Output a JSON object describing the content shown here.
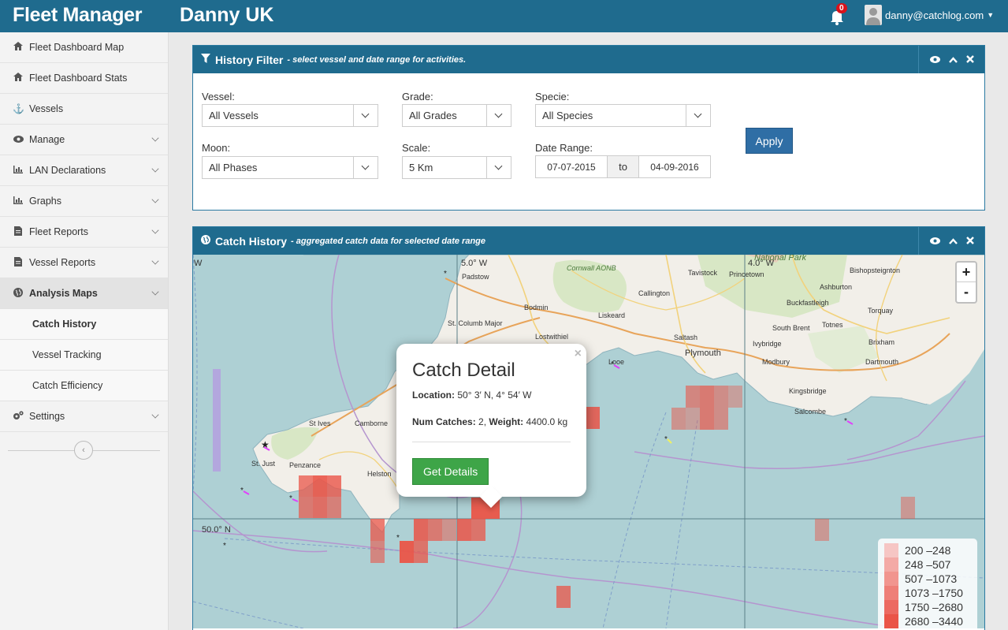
{
  "header": {
    "brand": "Fleet Manager",
    "org": "Danny UK",
    "notifications": "0",
    "user_email": "danny@catchlog.com"
  },
  "sidebar": {
    "items": [
      {
        "label": "Fleet Dashboard Map",
        "icon": "home-icon"
      },
      {
        "label": "Fleet Dashboard Stats",
        "icon": "home-icon"
      },
      {
        "label": "Vessels",
        "icon": "anchor-icon"
      },
      {
        "label": "Manage",
        "icon": "eye-icon"
      },
      {
        "label": "LAN Declarations",
        "icon": "bar-chart-icon"
      },
      {
        "label": "Graphs",
        "icon": "bar-chart-icon"
      },
      {
        "label": "Fleet Reports",
        "icon": "document-icon"
      },
      {
        "label": "Vessel Reports",
        "icon": "document-icon"
      },
      {
        "label": "Analysis Maps",
        "icon": "globe-icon"
      },
      {
        "label": "Settings",
        "icon": "gears-icon"
      }
    ],
    "sub_items": [
      "Catch History",
      "Vessel Tracking",
      "Catch Efficiency"
    ]
  },
  "filter": {
    "title": "History Filter",
    "subtitle": "- select vessel and date range for activities.",
    "vessel_label": "Vessel:",
    "vessel_value": "All Vessels",
    "grade_label": "Grade:",
    "grade_value": "All Grades",
    "specie_label": "Specie:",
    "specie_value": "All Species",
    "moon_label": "Moon:",
    "moon_value": "All Phases",
    "scale_label": "Scale:",
    "scale_value": "5 Km",
    "date_label": "Date Range:",
    "date_from": "07-07-2015",
    "date_to_label": "to",
    "date_to": "04-09-2016",
    "apply": "Apply"
  },
  "history": {
    "title": "Catch History",
    "subtitle": "- aggregated catch data for selected date range"
  },
  "map": {
    "labels": [
      {
        "name": "Padstow"
      },
      {
        "name": "Cornwall AONB"
      },
      {
        "name": "Bodmin"
      },
      {
        "name": "Tavistock"
      },
      {
        "name": "Princetown"
      },
      {
        "name": "Ashburton"
      },
      {
        "name": "Bishopsteignton"
      },
      {
        "name": "Callington"
      },
      {
        "name": "Buckfastleigh"
      },
      {
        "name": "St. Columb Major"
      },
      {
        "name": "Liskeard"
      },
      {
        "name": "Lostwithiel"
      },
      {
        "name": "South Brent"
      },
      {
        "name": "Totnes"
      },
      {
        "name": "Torquay"
      },
      {
        "name": "Saltash"
      },
      {
        "name": "Ivybridge"
      },
      {
        "name": "Brixham"
      },
      {
        "name": "Plymouth"
      },
      {
        "name": "Looe"
      },
      {
        "name": "Modbury"
      },
      {
        "name": "Dartmouth"
      },
      {
        "name": "Kingsbridge"
      },
      {
        "name": "Salcombe"
      },
      {
        "name": "St Ives"
      },
      {
        "name": "Camborne"
      },
      {
        "name": "St. Just"
      },
      {
        "name": "Penzance"
      },
      {
        "name": "Helston"
      }
    ],
    "grid_labels": [
      "5.0° W",
      "4.0° W",
      "50.0° N",
      "W",
      "National Park"
    ],
    "zoom_in": "+",
    "zoom_out": "-"
  },
  "popup": {
    "title": "Catch Detail",
    "location_label": "Location:",
    "location_value": "50° 3′ N, 4° 54′ W",
    "catches_label": "Num Catches:",
    "catches_value": "2,",
    "weight_label": "Weight:",
    "weight_value": "4400.0 kg",
    "button": "Get Details",
    "close": "×"
  },
  "legend": [
    {
      "range": "200 –248",
      "color": "#f6c6c4"
    },
    {
      "range": "248 –507",
      "color": "#f3aaa6"
    },
    {
      "range": "507 –1073",
      "color": "#f1958f"
    },
    {
      "range": "1073 –1750",
      "color": "#ee7f78"
    },
    {
      "range": "1750 –2680",
      "color": "#ec6a61"
    },
    {
      "range": "2680 –3440",
      "color": "#ea5548"
    }
  ],
  "colors": {
    "header": "#1f6b8e",
    "sea": "#aed0d4",
    "land": "#f2efe9",
    "cell": "#ea5548",
    "apply": "#2f6ea5",
    "green": "#3ea548"
  }
}
